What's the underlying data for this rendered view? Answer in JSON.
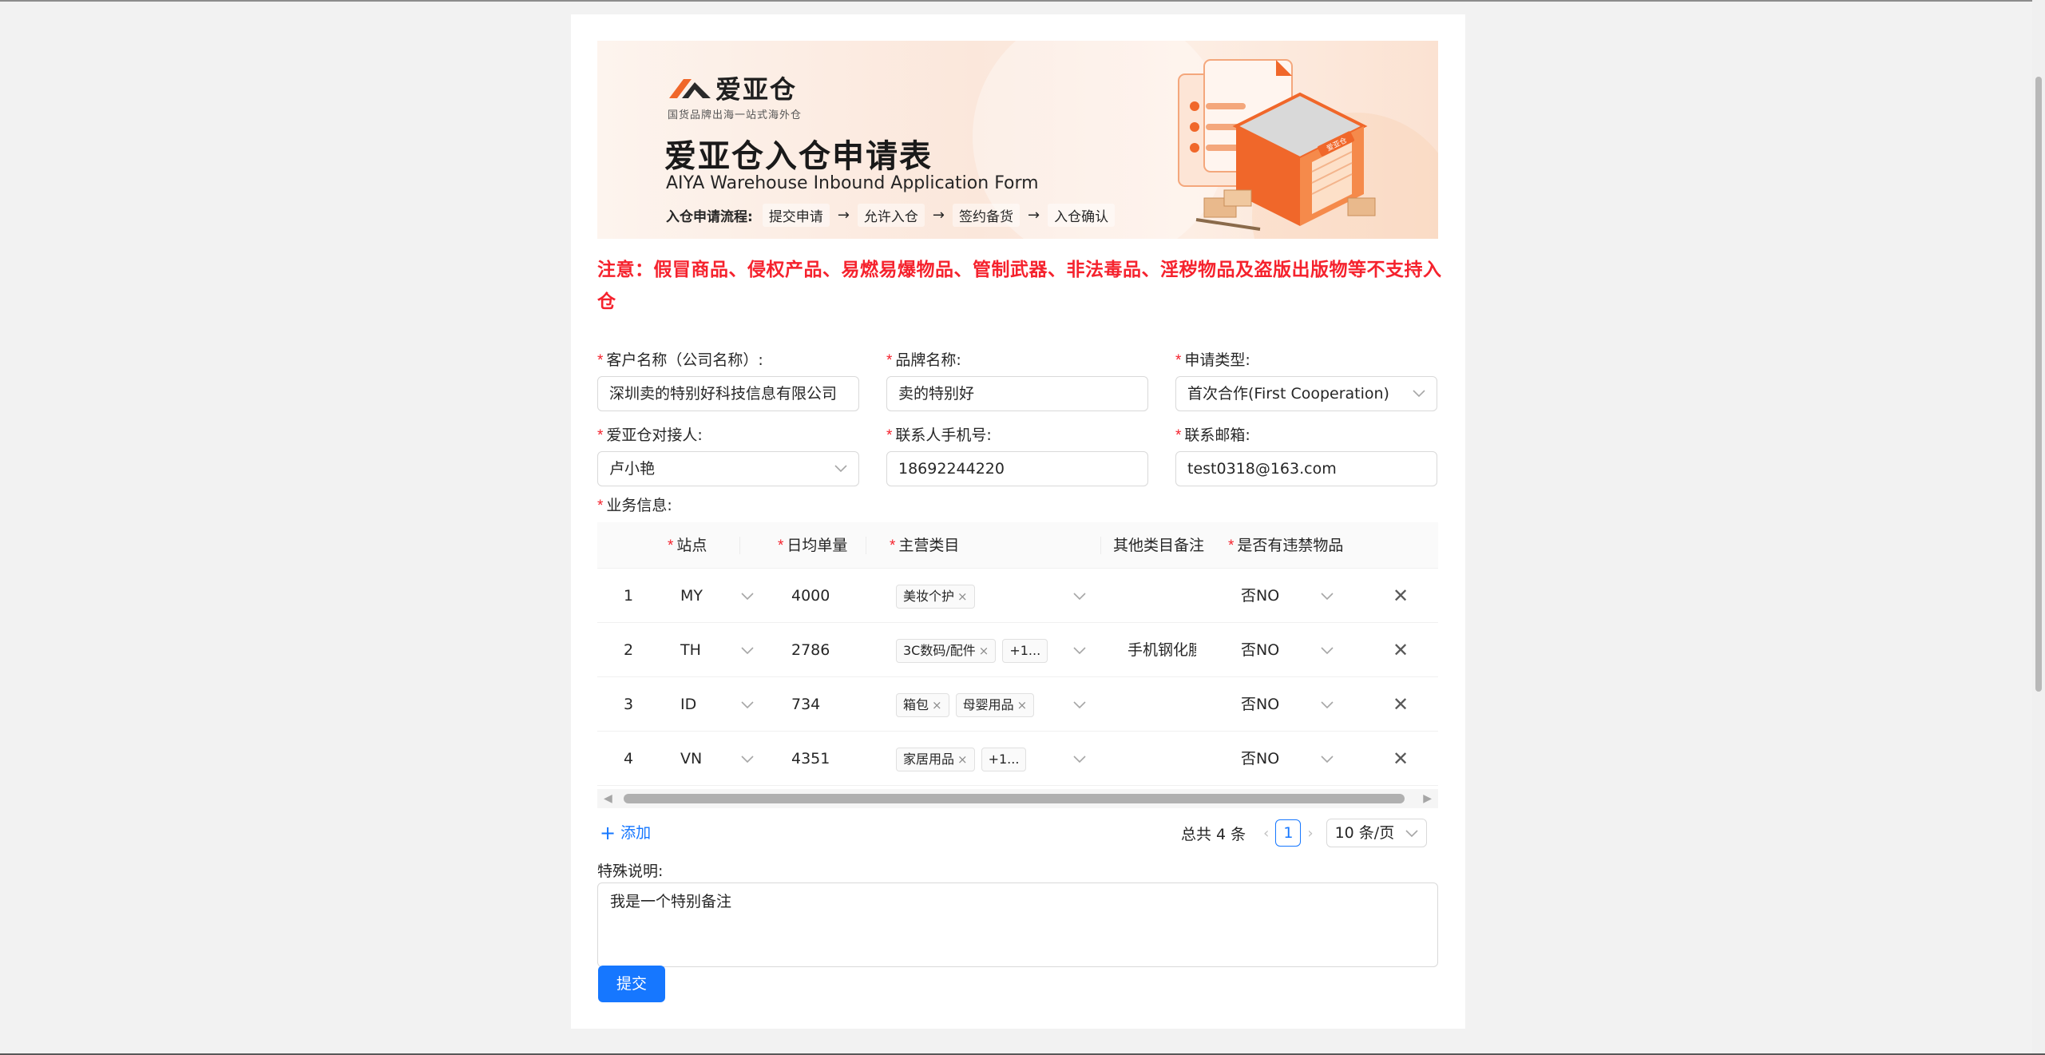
{
  "banner": {
    "brand": "爱亚仓",
    "slogan": "国货品牌出海一站式海外仓",
    "title": "爱亚仓入仓申请表",
    "title_en": "AIYA  Warehouse Inbound Application Form",
    "flow_label": "入仓申请流程:",
    "flow_steps": [
      "提交申请",
      "允许入仓",
      "签约备货",
      "入仓确认"
    ],
    "flow_arrow": "→",
    "box_label": "爱亚仓"
  },
  "notice": "注意：假冒商品、侵权产品、易燃易爆物品、管制武器、非法毒品、淫秽物品及盗版出版物等不支持入仓",
  "form": {
    "required_mark": "*",
    "customer": {
      "label": "客户名称（公司名称）:",
      "value": "深圳卖的特别好科技信息有限公司"
    },
    "brand": {
      "label": "品牌名称:",
      "value": "卖的特别好"
    },
    "apply_type": {
      "label": "申请类型:",
      "value": "首次合作(First Cooperation)"
    },
    "contact_person": {
      "label": "爱亚仓对接人:",
      "value": "卢小艳"
    },
    "phone": {
      "label": "联系人手机号:",
      "value": "18692244220"
    },
    "email": {
      "label": "联系邮箱:",
      "value": "test0318@163.com"
    },
    "business_label": "业务信息:",
    "note_label": "特殊说明:",
    "note_value": "我是一个特别备注",
    "submit_label": "提交"
  },
  "table": {
    "headers": {
      "site": "站点",
      "daily_orders": "日均单量",
      "category": "主营类目",
      "other_category_note": "其他类目备注",
      "prohibited": "是否有违禁物品"
    },
    "rows": [
      {
        "index": "1",
        "site": "MY",
        "daily_orders": "4000",
        "tags": [
          "美妆个护"
        ],
        "more": "",
        "other": "",
        "prohibited": "否NO"
      },
      {
        "index": "2",
        "site": "TH",
        "daily_orders": "2786",
        "tags": [
          "3C数码/配件"
        ],
        "more": "+1...",
        "other": "手机钢化膜",
        "prohibited": "否NO"
      },
      {
        "index": "3",
        "site": "ID",
        "daily_orders": "734",
        "tags": [
          "箱包",
          "母婴用品"
        ],
        "more": "",
        "other": "",
        "prohibited": "否NO"
      },
      {
        "index": "4",
        "site": "VN",
        "daily_orders": "4351",
        "tags": [
          "家居用品"
        ],
        "more": "+1...",
        "other": "",
        "prohibited": "否NO"
      }
    ],
    "add_label": "添加",
    "delete_glyph": "✕",
    "tag_close_glyph": "×"
  },
  "pagination": {
    "total": "总共 4 条",
    "current": "1",
    "page_size": "10 条/页",
    "prev_glyph": "‹",
    "next_glyph": "›"
  },
  "colors": {
    "accent": "#1677ff",
    "danger": "#f5222d",
    "brand_orange": "#f0672a"
  }
}
